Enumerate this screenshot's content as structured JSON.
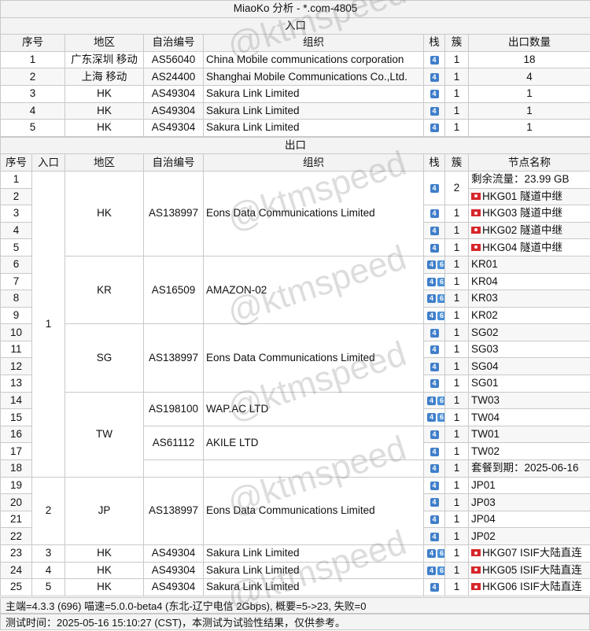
{
  "title": "MiaoKo 分析 - *.com-4805",
  "watermark": "@ktmspeed",
  "entry": {
    "section_label": "入口",
    "headers": [
      "序号",
      "地区",
      "自治编号",
      "组织",
      "栈",
      "簇",
      "出口数量"
    ],
    "rows": [
      {
        "idx": "1",
        "region": "广东深圳 移动",
        "asn": "AS56040",
        "org": "China Mobile communications corporation",
        "stack": "4",
        "cluster": "1",
        "count": "18"
      },
      {
        "idx": "2",
        "region": "上海 移动",
        "asn": "AS24400",
        "org": "Shanghai Mobile Communications Co.,Ltd.",
        "stack": "4",
        "cluster": "1",
        "count": "4"
      },
      {
        "idx": "3",
        "region": "HK",
        "asn": "AS49304",
        "org": "Sakura Link Limited",
        "stack": "4",
        "cluster": "1",
        "count": "1"
      },
      {
        "idx": "4",
        "region": "HK",
        "asn": "AS49304",
        "org": "Sakura Link Limited",
        "stack": "4",
        "cluster": "1",
        "count": "1"
      },
      {
        "idx": "5",
        "region": "HK",
        "asn": "AS49304",
        "org": "Sakura Link Limited",
        "stack": "4",
        "cluster": "1",
        "count": "1"
      }
    ]
  },
  "exit": {
    "section_label": "出口",
    "headers": [
      "序号",
      "入口",
      "地区",
      "自治编号",
      "组织",
      "栈",
      "簇",
      "节点名称"
    ],
    "rows": [
      {
        "idx": "1",
        "stack": "",
        "cluster": "",
        "name": "剩余流量：23.99 GB",
        "flag": false
      },
      {
        "idx": "2",
        "stack": "4",
        "cluster": "2",
        "name": "HKG01 隧道中继",
        "flag": true
      },
      {
        "idx": "3",
        "stack": "4",
        "cluster": "1",
        "name": "HKG03 隧道中继",
        "flag": true
      },
      {
        "idx": "4",
        "stack": "4",
        "cluster": "1",
        "name": "HKG02 隧道中继",
        "flag": true
      },
      {
        "idx": "5",
        "stack": "4",
        "cluster": "1",
        "name": "HKG04 隧道中继",
        "flag": true
      },
      {
        "idx": "6",
        "stack": "46",
        "cluster": "1",
        "name": "KR01",
        "flag": false
      },
      {
        "idx": "7",
        "stack": "46",
        "cluster": "1",
        "name": "KR04",
        "flag": false
      },
      {
        "idx": "8",
        "stack": "46",
        "cluster": "1",
        "name": "KR03",
        "flag": false
      },
      {
        "idx": "9",
        "stack": "46",
        "cluster": "1",
        "name": "KR02",
        "flag": false
      },
      {
        "idx": "10",
        "stack": "4",
        "cluster": "1",
        "name": "SG02",
        "flag": false
      },
      {
        "idx": "11",
        "stack": "4",
        "cluster": "1",
        "name": "SG03",
        "flag": false
      },
      {
        "idx": "12",
        "stack": "4",
        "cluster": "1",
        "name": "SG04",
        "flag": false
      },
      {
        "idx": "13",
        "stack": "4",
        "cluster": "1",
        "name": "SG01",
        "flag": false
      },
      {
        "idx": "14",
        "stack": "46",
        "cluster": "1",
        "name": "TW03",
        "flag": false
      },
      {
        "idx": "15",
        "stack": "46",
        "cluster": "1",
        "name": "TW04",
        "flag": false
      },
      {
        "idx": "16",
        "stack": "4",
        "cluster": "1",
        "name": "TW01",
        "flag": false
      },
      {
        "idx": "17",
        "stack": "4",
        "cluster": "1",
        "name": "TW02",
        "flag": false
      },
      {
        "idx": "18",
        "stack": "4",
        "cluster": "1",
        "name": "套餐到期：2025-06-16",
        "flag": false
      },
      {
        "idx": "19",
        "stack": "4",
        "cluster": "1",
        "name": "JP01",
        "flag": false
      },
      {
        "idx": "20",
        "stack": "4",
        "cluster": "1",
        "name": "JP03",
        "flag": false
      },
      {
        "idx": "21",
        "stack": "4",
        "cluster": "1",
        "name": "JP04",
        "flag": false
      },
      {
        "idx": "22",
        "stack": "4",
        "cluster": "1",
        "name": "JP02",
        "flag": false
      },
      {
        "idx": "23",
        "stack": "46",
        "cluster": "1",
        "name": "HKG07 ISIF大陆直连",
        "flag": true
      },
      {
        "idx": "24",
        "stack": "46",
        "cluster": "1",
        "name": "HKG05 ISIF大陆直连",
        "flag": true
      },
      {
        "idx": "25",
        "stack": "4",
        "cluster": "1",
        "name": "HKG06 ISIF大陆直连",
        "flag": true
      }
    ],
    "groups": {
      "entry_1": "1",
      "entry_2": "2",
      "entry_3": "3",
      "entry_4": "4",
      "entry_5": "5",
      "hk": {
        "region": "HK",
        "asn": "AS138997",
        "org": "Eons Data Communications Limited"
      },
      "kr": {
        "region": "KR",
        "asn": "AS16509",
        "org": "AMAZON-02"
      },
      "sg": {
        "region": "SG",
        "asn": "AS138997",
        "org": "Eons Data Communications Limited"
      },
      "tw": {
        "region": "TW",
        "asn1": "AS198100",
        "org1": "WAP.AC LTD",
        "asn2": "AS61112",
        "org2": "AKILE LTD"
      },
      "jp": {
        "region": "JP",
        "asn": "AS138997",
        "org": "Eons Data Communications Limited"
      },
      "r23": {
        "region": "HK",
        "asn": "AS49304",
        "org": "Sakura Link Limited"
      },
      "r24": {
        "region": "HK",
        "asn": "AS49304",
        "org": "Sakura Link Limited"
      },
      "r25": {
        "region": "HK",
        "asn": "AS49304",
        "org": "Sakura Link Limited"
      }
    }
  },
  "footer": {
    "line1": "主端=4.3.3 (696) 喵速=5.0.0-beta4 (东北-辽宁电信 2Gbps), 概要=5->23, 失败=0",
    "line2": "测试时间：2025-05-16 15:10:27 (CST)，本测试为试验性结果，仅供参考。"
  }
}
